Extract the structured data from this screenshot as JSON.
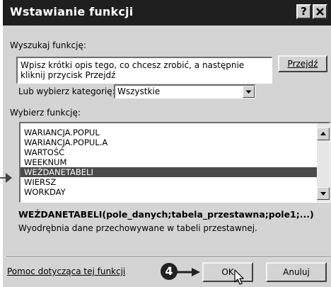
{
  "window": {
    "title": "Wstawianie funkcji",
    "help_button": "?",
    "close_button": "✕"
  },
  "search": {
    "label": "Wyszukaj funkcję:",
    "text": "Wpisz krótki opis tego, co chcesz zrobić, a następnie kliknij przycisk Przejdź",
    "go_button": "Przejdź"
  },
  "category": {
    "label": "Lub wybierz kategorię:",
    "selected": "Wszystkie"
  },
  "functions": {
    "label": "Wybierz funkcję:",
    "items": [
      "WARIANCJA.POPUL",
      "WARIANCJA.POPUL.A",
      "WARTOŚĆ",
      "WEEKNUM",
      "WEŹDANETABELI",
      "WIERSZ",
      "WORKDAY"
    ],
    "selected_index": 4
  },
  "details": {
    "syntax": "WEŹDANETABELI(pole_danych;tabela_przestawna;pole1;...)",
    "description": "Wyodrębnia dane przechowywane w tabeli przestawnej."
  },
  "footer": {
    "help_link": "Pomoc dotycząca tej funkcji",
    "step_number": "4",
    "ok_button": "OK",
    "cancel_button": "Anuluj"
  },
  "icons": {
    "scroll_up": "scroll-up-arrow-icon",
    "scroll_down": "scroll-down-arrow-icon",
    "dropdown": "chevron-down-icon",
    "cursor": "mouse-pointer-icon",
    "callout": "callout-arrow-icon"
  }
}
